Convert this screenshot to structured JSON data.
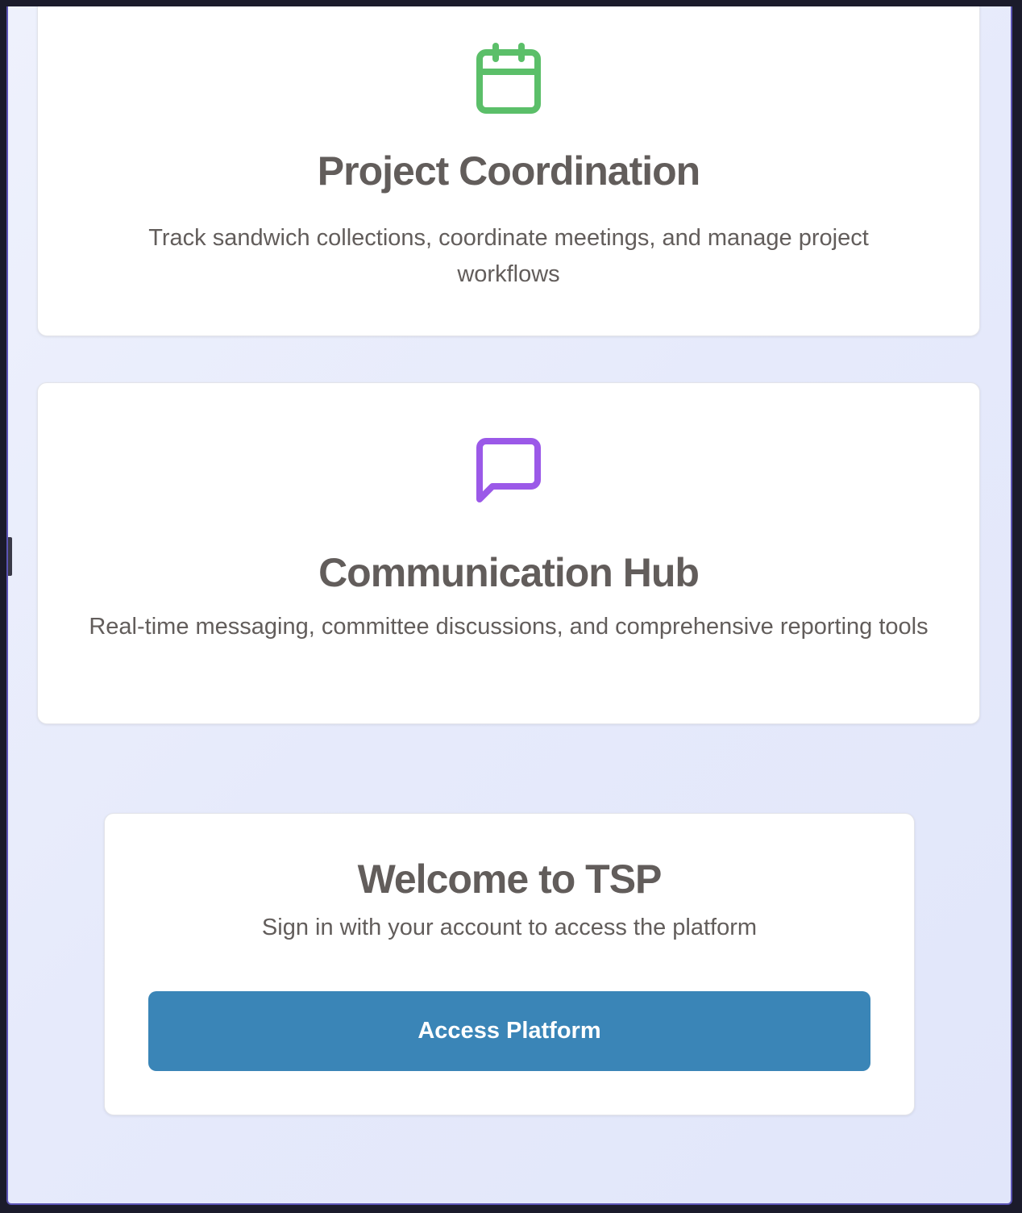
{
  "features": [
    {
      "icon": "calendar-icon",
      "icon_color": "#5bbf69",
      "title": "Project Coordination",
      "description": "Track sandwich collections, coordinate meetings, and manage project workflows"
    },
    {
      "icon": "message-square-icon",
      "icon_color": "#9b59e8",
      "title": "Communication Hub",
      "description": "Real-time messaging, committee discussions, and comprehensive reporting tools"
    }
  ],
  "welcome": {
    "title": "Welcome to TSP",
    "subtitle": "Sign in with your account to access the platform",
    "button_label": "Access Platform",
    "button_color": "#3a85b7"
  }
}
